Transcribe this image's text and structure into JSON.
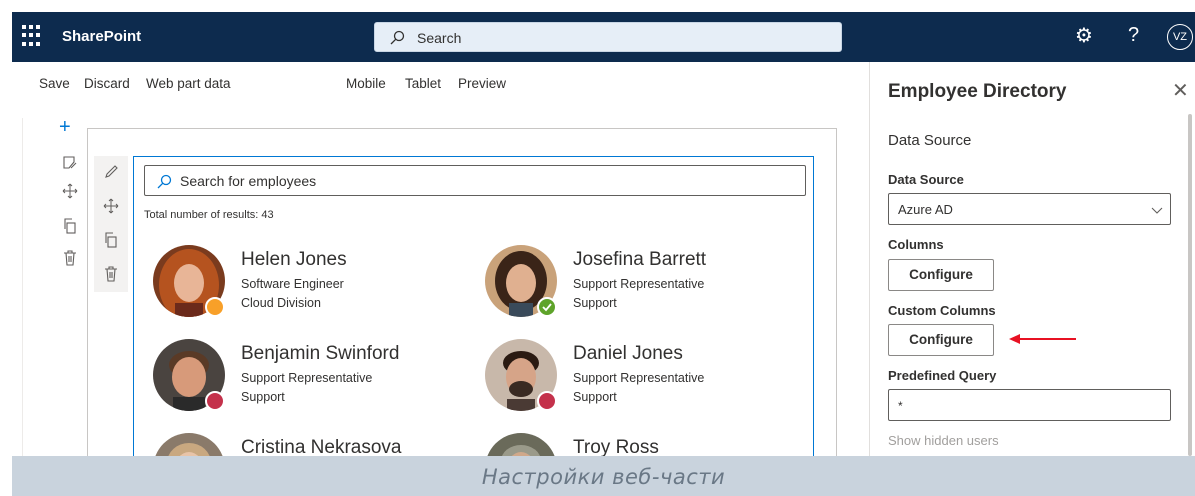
{
  "suite_bar": {
    "app_name": "SharePoint",
    "search_placeholder": "Search",
    "user_initials": "VZ"
  },
  "command_bar": {
    "save": "Save",
    "discard": "Discard",
    "web_part_data": "Web part data",
    "mobile": "Mobile",
    "tablet": "Tablet",
    "preview": "Preview"
  },
  "web_part": {
    "search_placeholder": "Search for employees",
    "results_label": "Total number of results: 43",
    "people": [
      {
        "name": "Helen Jones",
        "title": "Software Engineer",
        "department": "Cloud Division",
        "presence": "away"
      },
      {
        "name": "Josefina Barrett",
        "title": "Support Representative",
        "department": "Support",
        "presence": "available"
      },
      {
        "name": "Benjamin Swinford",
        "title": "Support Representative",
        "department": "Support",
        "presence": "busy"
      },
      {
        "name": "Daniel Jones",
        "title": "Support Representative",
        "department": "Support",
        "presence": "busy"
      },
      {
        "name": "Cristina Nekrasova",
        "title": "",
        "department": "",
        "presence": ""
      },
      {
        "name": "Troy Ross",
        "title": "",
        "department": "",
        "presence": ""
      }
    ]
  },
  "property_pane": {
    "title": "Employee Directory",
    "group": "Data Source",
    "data_source_label": "Data Source",
    "data_source_value": "Azure AD",
    "columns_label": "Columns",
    "columns_button": "Configure",
    "custom_columns_label": "Custom Columns",
    "custom_columns_button": "Configure",
    "predefined_query_label": "Predefined Query",
    "predefined_query_value": "*",
    "show_hidden_users": "Show hidden users"
  },
  "caption": "Настройки веб-части",
  "colors": {
    "suite_bar": "#0d2b4e",
    "accent": "#0078d4",
    "presence_away": "#f8a029",
    "presence_available": "#5ea32a",
    "presence_busy": "#c4314b",
    "arrow": "#e81123"
  }
}
